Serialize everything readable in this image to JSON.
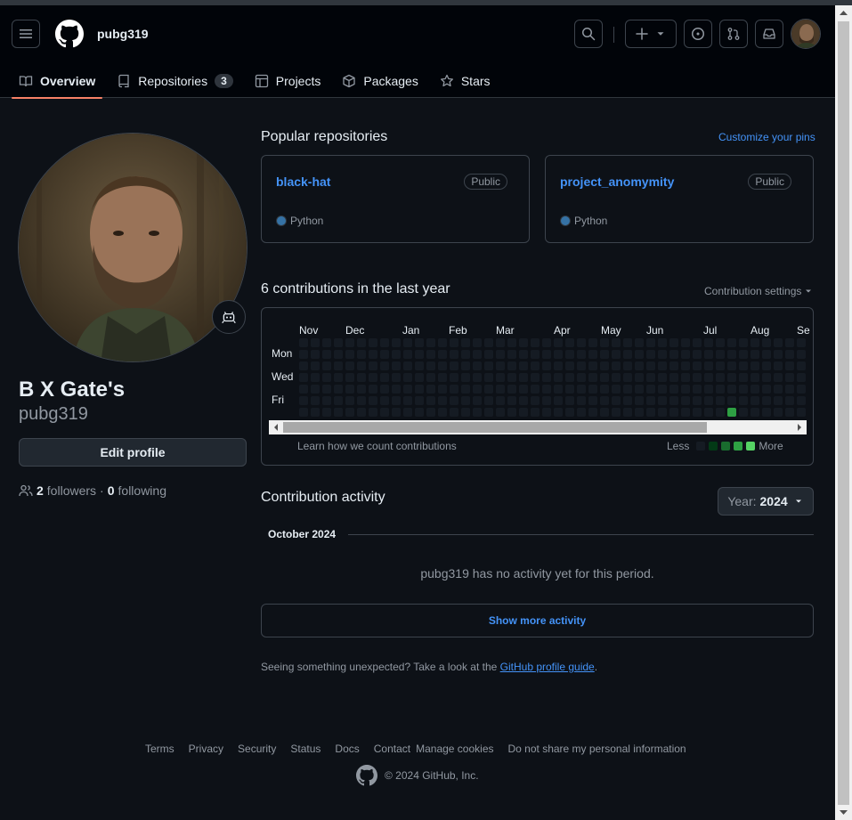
{
  "header": {
    "owner": "pubg319"
  },
  "tabs": [
    {
      "label": "Overview"
    },
    {
      "label": "Repositories",
      "count": "3"
    },
    {
      "label": "Projects"
    },
    {
      "label": "Packages"
    },
    {
      "label": "Stars"
    }
  ],
  "profile": {
    "display_name": "B X Gate's",
    "login": "pubg319",
    "edit_label": "Edit profile",
    "followers_count": "2",
    "followers_label": "followers",
    "separator": "·",
    "following_count": "0",
    "following_label": "following"
  },
  "pinned": {
    "title": "Popular repositories",
    "customize": "Customize your pins",
    "repos": [
      {
        "name": "black-hat",
        "visibility": "Public",
        "language": "Python",
        "language_color": "#3572A5"
      },
      {
        "name": "project_anomymity",
        "visibility": "Public",
        "language": "Python",
        "language_color": "#3572A5"
      }
    ]
  },
  "contributions": {
    "title": "6 contributions in the last year",
    "settings": "Contribution settings",
    "months": [
      "Nov",
      "Dec",
      "Jan",
      "Feb",
      "Mar",
      "Apr",
      "May",
      "Jun",
      "Jul",
      "Aug",
      "Se"
    ],
    "day_labels": [
      "Mon",
      "Wed",
      "Fri"
    ],
    "learn": "Learn how we count contributions",
    "less": "Less",
    "more": "More",
    "legend_colors": [
      "#151b23",
      "#033a16",
      "#196c2e",
      "#2ea043",
      "#56d364"
    ],
    "active_cell_color": "#2ea043"
  },
  "activity": {
    "title": "Contribution activity",
    "year_prefix": "Year:",
    "year": "2024",
    "month_heading": "October 2024",
    "no_activity": "pubg319 has no activity yet for this period.",
    "show_more": "Show more activity",
    "guide_text": "Seeing something unexpected? Take a look at the ",
    "guide_link": "GitHub profile guide",
    "guide_end": "."
  },
  "footer": {
    "links": [
      "Terms",
      "Privacy",
      "Security",
      "Status",
      "Docs",
      "Contact",
      "Manage cookies",
      "Do not share my personal information"
    ],
    "copyright": "© 2024 GitHub, Inc."
  }
}
